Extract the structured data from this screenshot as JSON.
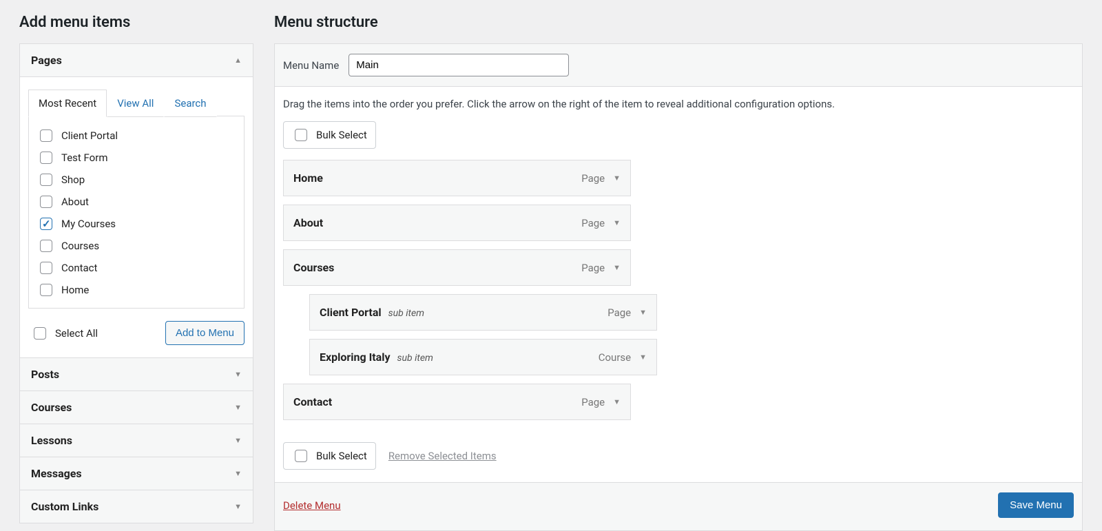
{
  "left": {
    "heading": "Add menu items",
    "panels": {
      "pages": {
        "title": "Pages",
        "tabs": {
          "recent": "Most Recent",
          "view_all": "View All",
          "search": "Search"
        },
        "items": [
          {
            "label": "Client Portal",
            "checked": false
          },
          {
            "label": "Test Form",
            "checked": false
          },
          {
            "label": "Shop",
            "checked": false
          },
          {
            "label": "About",
            "checked": false
          },
          {
            "label": "My Courses",
            "checked": true
          },
          {
            "label": "Courses",
            "checked": false
          },
          {
            "label": "Contact",
            "checked": false
          },
          {
            "label": "Home",
            "checked": false
          }
        ],
        "select_all": "Select All",
        "add_button": "Add to Menu"
      },
      "posts": {
        "title": "Posts"
      },
      "courses": {
        "title": "Courses"
      },
      "lessons": {
        "title": "Lessons"
      },
      "messages": {
        "title": "Messages"
      },
      "custom_links": {
        "title": "Custom Links"
      }
    }
  },
  "right": {
    "heading": "Menu structure",
    "menu_name_label": "Menu Name",
    "menu_name_value": "Main",
    "instructions": "Drag the items into the order you prefer. Click the arrow on the right of the item to reveal additional configuration options.",
    "bulk_select": "Bulk Select",
    "sub_item_note": "sub item",
    "items": [
      {
        "title": "Home",
        "type": "Page",
        "sub": false
      },
      {
        "title": "About",
        "type": "Page",
        "sub": false
      },
      {
        "title": "Courses",
        "type": "Page",
        "sub": false
      },
      {
        "title": "Client Portal",
        "type": "Page",
        "sub": true
      },
      {
        "title": "Exploring Italy",
        "type": "Course",
        "sub": true
      },
      {
        "title": "Contact",
        "type": "Page",
        "sub": false
      }
    ],
    "remove_selected": "Remove Selected Items",
    "delete_menu": "Delete Menu",
    "save_menu": "Save Menu"
  }
}
